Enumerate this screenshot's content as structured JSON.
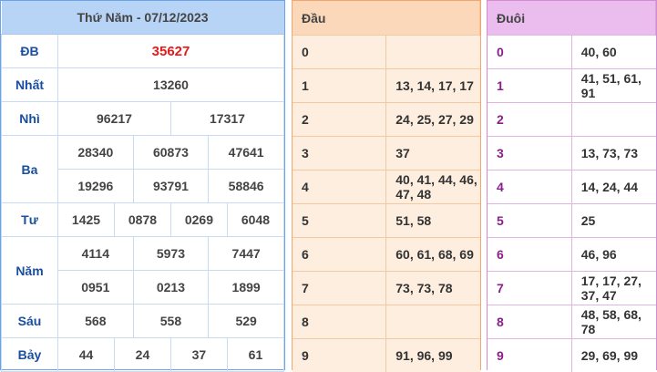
{
  "title": "Thứ Năm - 07/12/2023",
  "prizes": [
    {
      "label": "ĐB",
      "values": [
        "35627"
      ]
    },
    {
      "label": "Nhất",
      "values": [
        "13260"
      ]
    },
    {
      "label": "Nhì",
      "values": [
        "96217",
        "17317"
      ]
    },
    {
      "label": "Ba",
      "values": [
        "28340",
        "60873",
        "47641",
        "19296",
        "93791",
        "58846"
      ]
    },
    {
      "label": "Tư",
      "values": [
        "1425",
        "0878",
        "0269",
        "6048"
      ]
    },
    {
      "label": "Năm",
      "values": [
        "4114",
        "5973",
        "7447",
        "0951",
        "0213",
        "1899"
      ]
    },
    {
      "label": "Sáu",
      "values": [
        "568",
        "558",
        "529"
      ]
    },
    {
      "label": "Bảy",
      "values": [
        "44",
        "24",
        "37",
        "61"
      ]
    }
  ],
  "dau": {
    "header": "Đầu",
    "rows": [
      {
        "digit": "0",
        "values": ""
      },
      {
        "digit": "1",
        "values": "13, 14, 17, 17"
      },
      {
        "digit": "2",
        "values": "24, 25, 27, 29"
      },
      {
        "digit": "3",
        "values": "37"
      },
      {
        "digit": "4",
        "values": "40, 41, 44, 46, 47, 48"
      },
      {
        "digit": "5",
        "values": "51, 58"
      },
      {
        "digit": "6",
        "values": "60, 61, 68, 69"
      },
      {
        "digit": "7",
        "values": "73, 73, 78"
      },
      {
        "digit": "8",
        "values": ""
      },
      {
        "digit": "9",
        "values": "91, 96, 99"
      }
    ]
  },
  "duoi": {
    "header": "Đuôi",
    "rows": [
      {
        "digit": "0",
        "values": "40, 60"
      },
      {
        "digit": "1",
        "values": "41, 51, 61, 91"
      },
      {
        "digit": "2",
        "values": ""
      },
      {
        "digit": "3",
        "values": "13, 73, 73"
      },
      {
        "digit": "4",
        "values": "14, 24, 44"
      },
      {
        "digit": "5",
        "values": "25"
      },
      {
        "digit": "6",
        "values": "46, 96"
      },
      {
        "digit": "7",
        "values": "17, 17, 27, 37, 47"
      },
      {
        "digit": "8",
        "values": "48, 58, 68, 78"
      },
      {
        "digit": "9",
        "values": "29, 69, 99"
      }
    ]
  },
  "colors": {
    "special_prize": "#e41b1b",
    "label": "#1a4fa0",
    "results_header_bg": "#b7d4f6",
    "dau_header_bg": "#fad8b9",
    "dau_body_bg": "#fdeedf",
    "duoi_header_bg": "#ebbdee"
  }
}
